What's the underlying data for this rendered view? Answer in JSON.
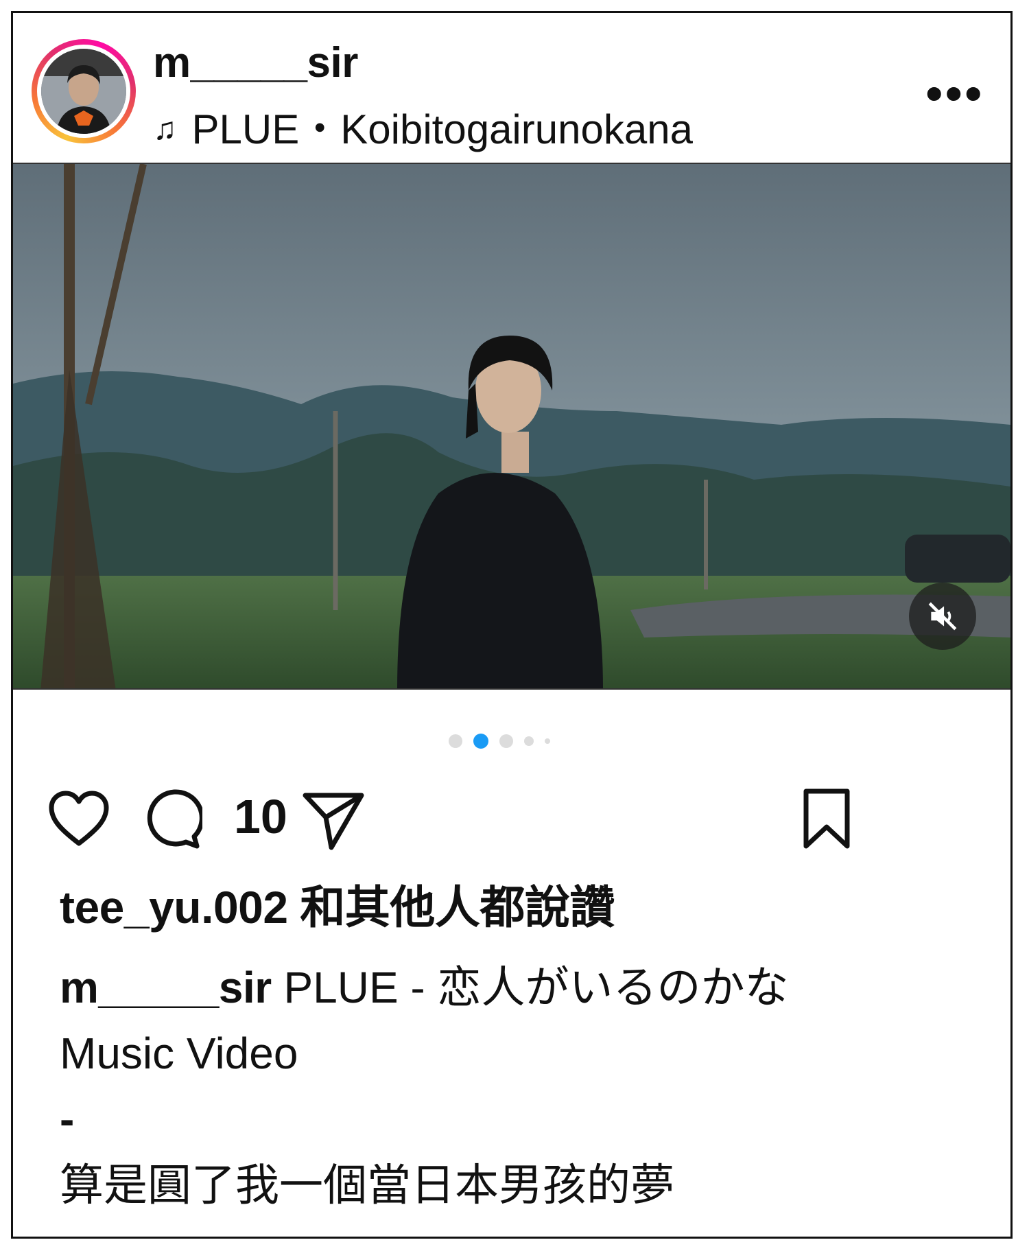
{
  "post": {
    "username": "m_____sir",
    "music_note_icon": "♫",
    "music": "PLUE・Koibitogairunokana",
    "more_icon": "•••"
  },
  "media": {
    "carousel_total": 5,
    "carousel_active_index": 1,
    "muted": true,
    "accent_color": "#1a9bf5"
  },
  "actions": {
    "comment_count": "10"
  },
  "likes": {
    "text": "tee_yu.002 和其他人都說讚"
  },
  "caption": {
    "username": "m_____sir",
    "text_line1": "PLUE - 恋人がいるのかな",
    "text_line2": "Music Video",
    "text_line3": "-",
    "text_line4": "算是圓了我一個當日本男孩的夢"
  }
}
